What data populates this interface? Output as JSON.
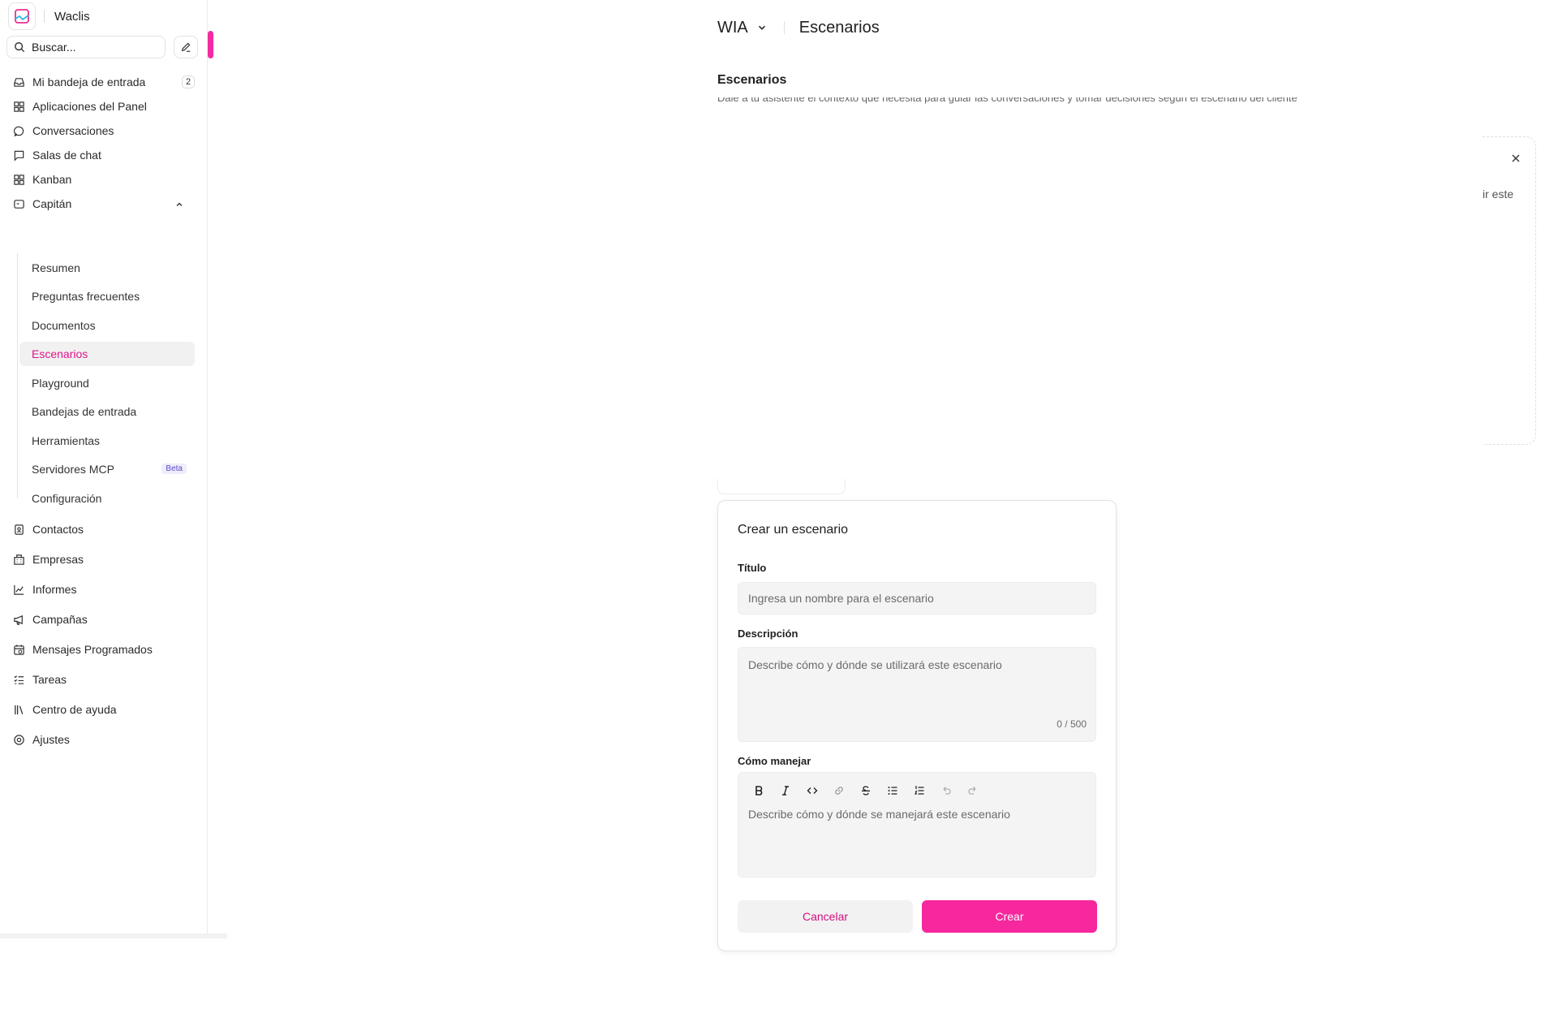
{
  "colors": {
    "accent": "#f7289e",
    "accent_text": "#e0158b",
    "sidebar_border": "#ebebeb"
  },
  "brand": {
    "name": "Waclis"
  },
  "search": {
    "placeholder": "Buscar..."
  },
  "sidebar": {
    "items": [
      {
        "label": "Mi bandeja de entrada",
        "icon": "inbox-icon",
        "badge": "2"
      },
      {
        "label": "Aplicaciones del Panel",
        "icon": "grid-icon"
      },
      {
        "label": "Conversaciones",
        "icon": "chat-bubble-icon"
      },
      {
        "label": "Salas de chat",
        "icon": "message-square-icon"
      },
      {
        "label": "Kanban",
        "icon": "kanban-icon"
      },
      {
        "label": "Capitán",
        "icon": "captain-icon"
      }
    ],
    "captain_sub": [
      {
        "label": "Resumen"
      },
      {
        "label": "Preguntas frecuentes"
      },
      {
        "label": "Documentos"
      },
      {
        "label": "Escenarios",
        "active": true
      },
      {
        "label": "Playground"
      },
      {
        "label": "Bandejas de entrada"
      },
      {
        "label": "Herramientas"
      },
      {
        "label": "Servidores MCP",
        "badge": "Beta"
      },
      {
        "label": "Configuración"
      }
    ],
    "bottom_items": [
      {
        "label": "Contactos",
        "icon": "contact-icon"
      },
      {
        "label": "Empresas",
        "icon": "building-icon"
      },
      {
        "label": "Informes",
        "icon": "chart-line-icon"
      },
      {
        "label": "Campañas",
        "icon": "megaphone-icon"
      },
      {
        "label": "Mensajes Programados",
        "icon": "calendar-clock-icon"
      },
      {
        "label": "Tareas",
        "icon": "list-check-icon"
      },
      {
        "label": "Centro de ayuda",
        "icon": "library-icon"
      },
      {
        "label": "Ajustes",
        "icon": "settings-icon"
      }
    ]
  },
  "header": {
    "workspace": "WIA",
    "page_title": "Escenarios"
  },
  "section": {
    "title": "Escenarios",
    "subtitle": "Dale a tu asistente el contexto que necesita para guiar las conversaciones y tomar decisiones según el escenario del cliente"
  },
  "background_card": {
    "clipped_text": "ir este"
  },
  "modal": {
    "title": "Crear un escenario",
    "title_label": "Título",
    "title_placeholder": "Ingresa un nombre para el escenario",
    "description_label": "Descripción",
    "description_placeholder": "Describe cómo y dónde se utilizará este escenario",
    "char_count": "0 / 500",
    "handle_label": "Cómo manejar",
    "handle_placeholder": "Describe cómo y dónde se manejará este escenario",
    "cancel_label": "Cancelar",
    "create_label": "Crear"
  }
}
